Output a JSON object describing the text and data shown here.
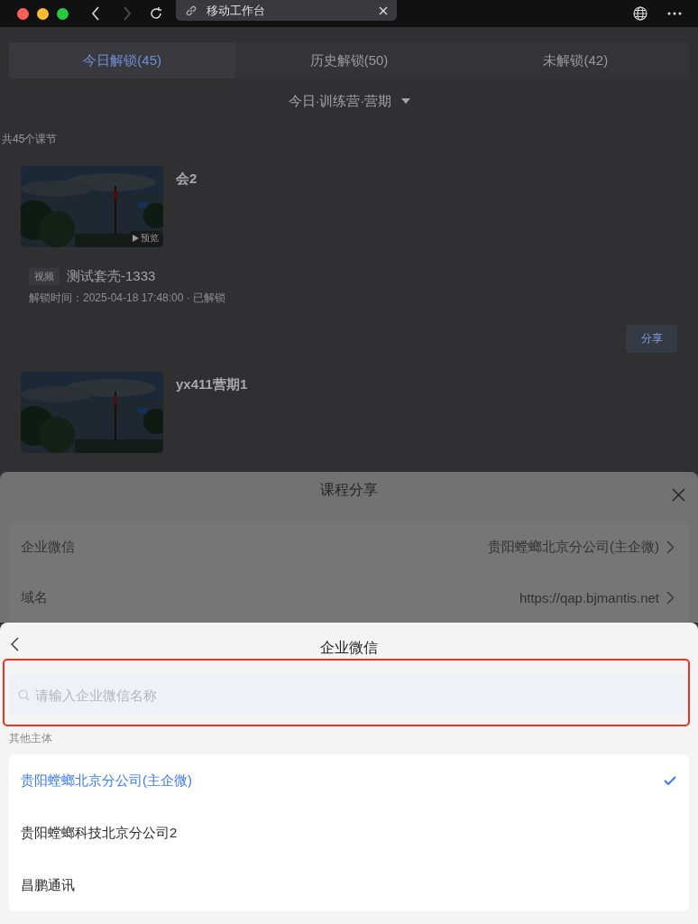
{
  "browser": {
    "tab_title": "移动工作台"
  },
  "tabs": [
    {
      "label": "今日解锁(45)",
      "selected": true
    },
    {
      "label": "历史解锁(50)",
      "selected": false
    },
    {
      "label": "未解锁(42)",
      "selected": false
    }
  ],
  "filter": {
    "label": "今日·训练营·营期"
  },
  "count": "共45个课节",
  "courses": [
    {
      "title": "会2",
      "preview": "预览",
      "tag": "视频",
      "name": "测试套壳-1333",
      "unlock": "解锁时间：2025-04-18 17:48:00 · 已解锁",
      "share": "分享"
    },
    {
      "title": "yx411营期1"
    }
  ],
  "share_sheet": {
    "title": "课程分享",
    "rows": [
      {
        "label": "企业微信",
        "value": "贵阳螳螂北京分公司(主企微)"
      },
      {
        "label": "域名",
        "value": "https://qap.bjmantis.net"
      }
    ]
  },
  "picker": {
    "title": "企业微信",
    "search": {
      "placeholder": "请输入企业微信名称"
    },
    "section": "其他主体",
    "options": [
      {
        "label": "贵阳螳螂北京分公司(主企微)",
        "selected": true
      },
      {
        "label": "贵阳螳螂科技北京分公司2",
        "selected": false
      },
      {
        "label": "昌鹏通讯",
        "selected": false
      }
    ]
  }
}
